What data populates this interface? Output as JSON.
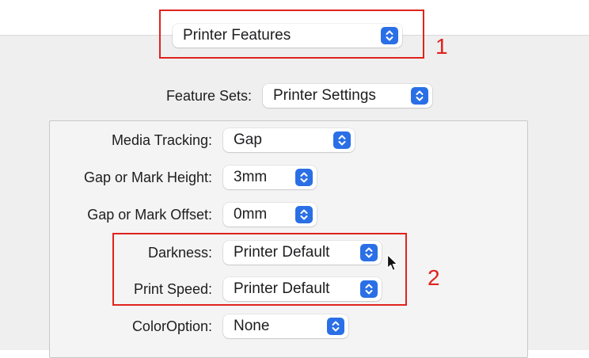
{
  "top_popup": {
    "value": "Printer Features"
  },
  "feature_sets": {
    "label": "Feature Sets:",
    "value": "Printer Settings"
  },
  "settings": [
    {
      "label": "Media Tracking:",
      "value": "Gap"
    },
    {
      "label": "Gap or Mark Height:",
      "value": "3mm"
    },
    {
      "label": "Gap or Mark Offset:",
      "value": "0mm"
    },
    {
      "label": "Darkness:",
      "value": "Printer Default"
    },
    {
      "label": "Print Speed:",
      "value": "Printer Default"
    },
    {
      "label": "ColorOption:",
      "value": "None"
    }
  ],
  "callouts": {
    "one": "1",
    "two": "2"
  },
  "icons": {
    "stepper": "chevron-up-down-icon",
    "cursor": "mouse-pointer-icon"
  },
  "colors": {
    "accent": "#2a6fe6",
    "annotation": "#e0231e"
  }
}
